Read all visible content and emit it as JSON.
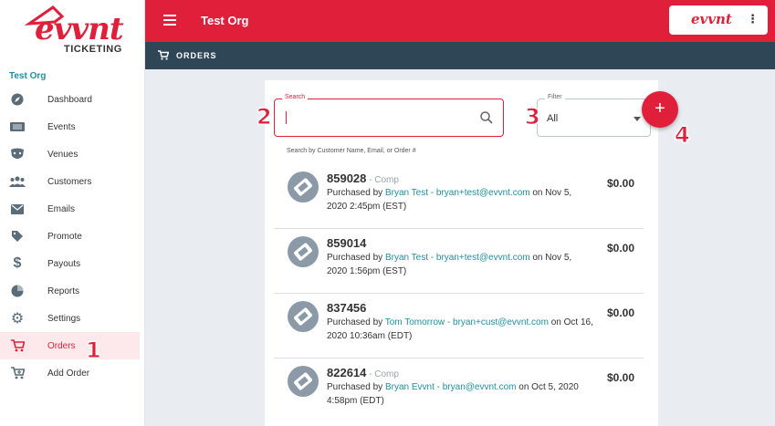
{
  "app": {
    "logo_text": "evvnt",
    "logo_sub": "TICKETING",
    "org_name": "Test Org",
    "brand_colors": {
      "accent": "#e0203b",
      "dark": "#2f4657",
      "link": "#1f8fa0"
    }
  },
  "header": {
    "title": "Test Org",
    "brand_button": "evvnt",
    "more_glyph": "⋮"
  },
  "subheader": {
    "title": "ORDERS"
  },
  "sidebar": {
    "org_label": "Test Org",
    "items": [
      {
        "label": "Dashboard",
        "icon": "compass-icon"
      },
      {
        "label": "Events",
        "icon": "ticket-icon"
      },
      {
        "label": "Venues",
        "icon": "theater-icon"
      },
      {
        "label": "Customers",
        "icon": "people-icon"
      },
      {
        "label": "Emails",
        "icon": "mail-icon"
      },
      {
        "label": "Promote",
        "icon": "tag-icon"
      },
      {
        "label": "Payouts",
        "icon": "dollar-icon"
      },
      {
        "label": "Reports",
        "icon": "pie-chart-icon"
      },
      {
        "label": "Settings",
        "icon": "gear-icon"
      },
      {
        "label": "Orders",
        "icon": "cart-icon",
        "active": true
      },
      {
        "label": "Add Order",
        "icon": "cart-add-icon"
      }
    ]
  },
  "search": {
    "legend": "Search",
    "value": "",
    "hint": "Search by Customer Name, Email, or Order #"
  },
  "filter": {
    "legend": "Filter",
    "value": "All"
  },
  "fab": {
    "label": "+"
  },
  "annotations": [
    "1",
    "2",
    "3",
    "4"
  ],
  "orders": [
    {
      "number": "859028",
      "tag": " - Comp",
      "prefix": "Purchased by ",
      "customer": "Bryan Test - bryan+test@evvnt.com",
      "suffix": " on Nov 5, 2020 2:45pm (EST)",
      "amount": "$0.00"
    },
    {
      "number": "859014",
      "tag": "",
      "prefix": "Purchased by ",
      "customer": "Bryan Test - bryan+test@evvnt.com",
      "suffix": " on Nov 5, 2020 1:56pm (EST)",
      "amount": "$0.00"
    },
    {
      "number": "837456",
      "tag": "",
      "prefix": "Purchased by ",
      "customer": "Tom Tomorrow - bryan+cust@evvnt.com",
      "suffix": " on Oct 16, 2020 10:36am (EDT)",
      "amount": "$0.00"
    },
    {
      "number": "822614",
      "tag": " - Comp",
      "prefix": "Purchased by ",
      "customer": "Bryan Evvnt - bryan@evvnt.com",
      "suffix": " on Oct 5, 2020 4:58pm (EDT)",
      "amount": "$0.00"
    }
  ]
}
